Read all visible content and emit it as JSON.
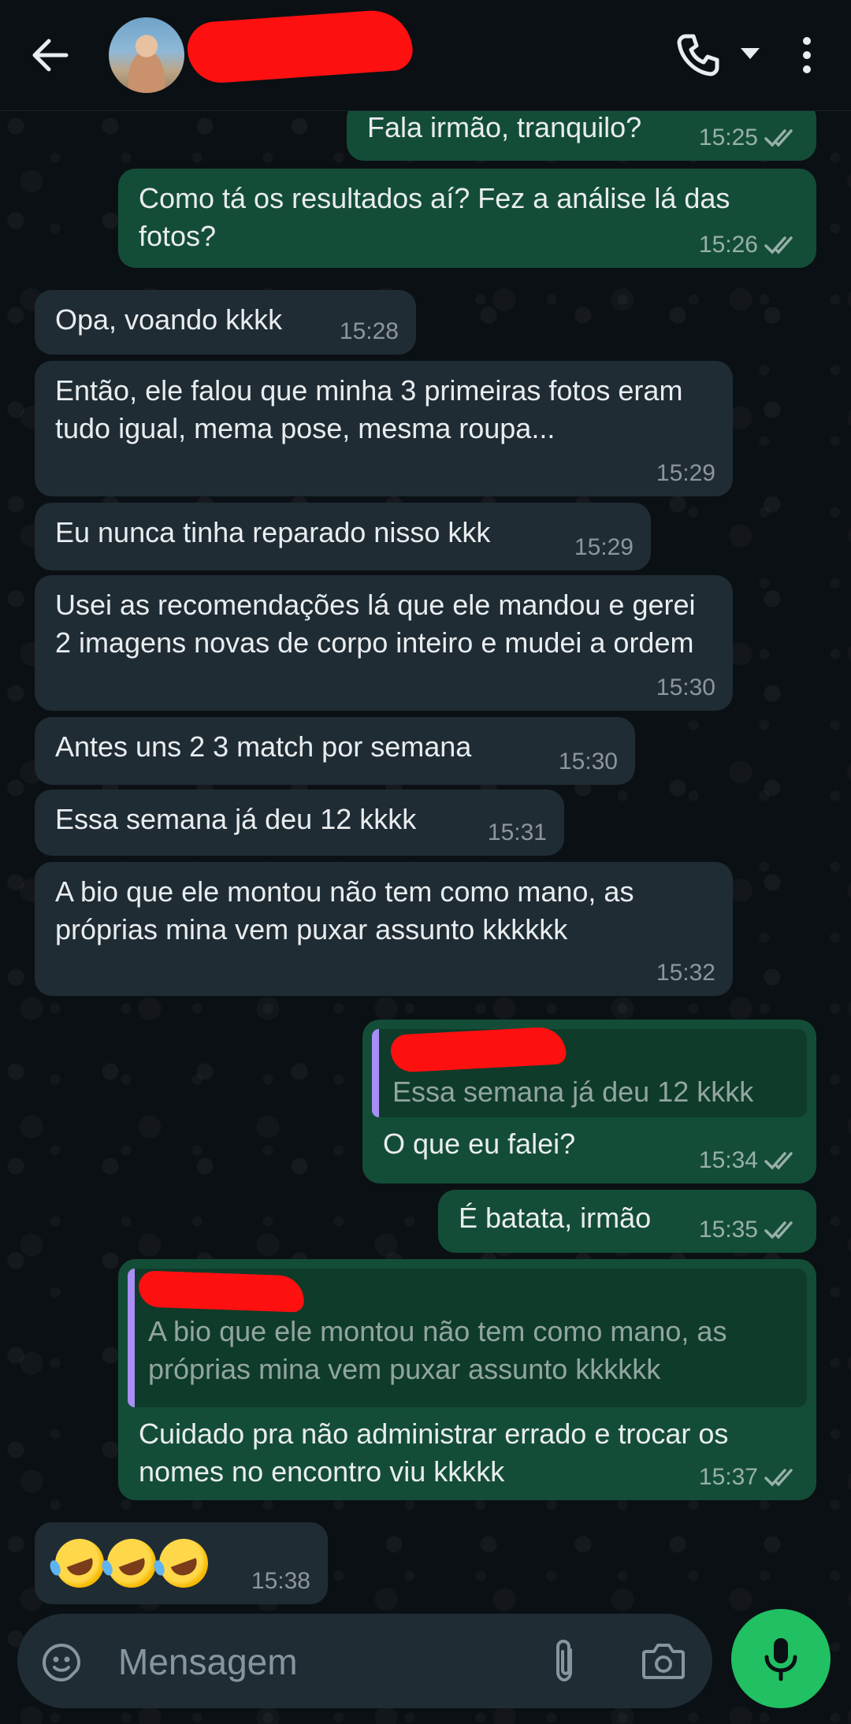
{
  "header": {
    "contact_name": ""
  },
  "input": {
    "placeholder": "Mensagem"
  },
  "messages": [
    {
      "dir": "out",
      "text": "Fala irmão, tranquilo?",
      "time": "15:25"
    },
    {
      "dir": "out",
      "text": "Como tá os resultados aí? Fez a análise lá das fotos?",
      "time": "15:26"
    },
    {
      "dir": "in",
      "text": "Opa, voando kkkk",
      "time": "15:28"
    },
    {
      "dir": "in",
      "text": "Então, ele falou que minha 3 primeiras fotos eram tudo igual, mema pose, mesma roupa...",
      "time": "15:29"
    },
    {
      "dir": "in",
      "text": "Eu nunca tinha reparado nisso kkk",
      "time": "15:29"
    },
    {
      "dir": "in",
      "text": "Usei as recomendações lá que ele mandou e gerei 2 imagens novas de corpo inteiro e mudei a ordem",
      "time": "15:30"
    },
    {
      "dir": "in",
      "text": "Antes uns 2 3 match por semana",
      "time": "15:30"
    },
    {
      "dir": "in",
      "text": "Essa semana já deu 12 kkkk",
      "time": "15:31"
    },
    {
      "dir": "in",
      "text": "A bio que ele montou não tem como mano, as próprias mina vem puxar assunto kkkkkk",
      "time": "15:32"
    },
    {
      "dir": "out",
      "quote": "Essa semana já deu 12 kkkk",
      "text": "O que eu falei?",
      "time": "15:34"
    },
    {
      "dir": "out",
      "text": "É batata, irmão",
      "time": "15:35"
    },
    {
      "dir": "out",
      "quote": "A bio que ele montou não tem como mano, as próprias mina vem puxar assunto kkkkkk",
      "text": "Cuidado pra não administrar errado e trocar os nomes no encontro viu kkkkk",
      "time": "15:37"
    },
    {
      "dir": "in",
      "text": "",
      "emoji_count": 3,
      "time": "15:38"
    }
  ]
}
